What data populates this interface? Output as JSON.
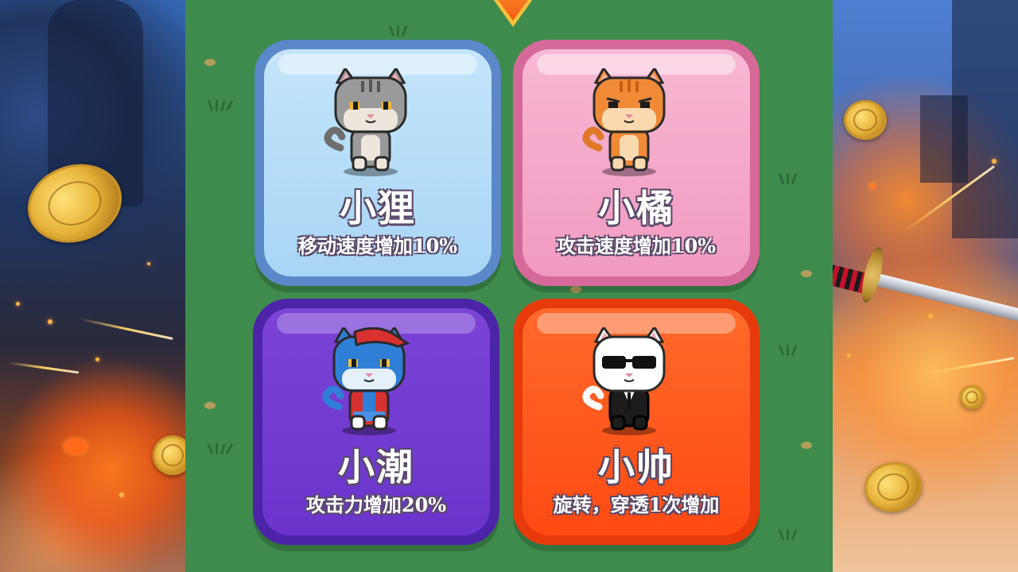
{
  "cards": [
    {
      "name": "小狸",
      "description": "移动速度增加10%",
      "cat_icon": "gray-tabby-cat-icon"
    },
    {
      "name": "小橘",
      "description": "攻击速度增加10%",
      "cat_icon": "orange-cat-icon"
    },
    {
      "name": "小潮",
      "description": "攻击力增加20%",
      "cat_icon": "blue-cat-red-cap-icon"
    },
    {
      "name": "小帅",
      "description": "旋转，穿透1次增加",
      "cat_icon": "white-cat-sunglasses-suit-icon"
    }
  ],
  "colors": {
    "field": "#3f8b4d",
    "card_blue": "#a9d5f5",
    "card_pink": "#f19ac0",
    "card_purple": "#6a34cc",
    "card_red": "#ff4a12"
  }
}
